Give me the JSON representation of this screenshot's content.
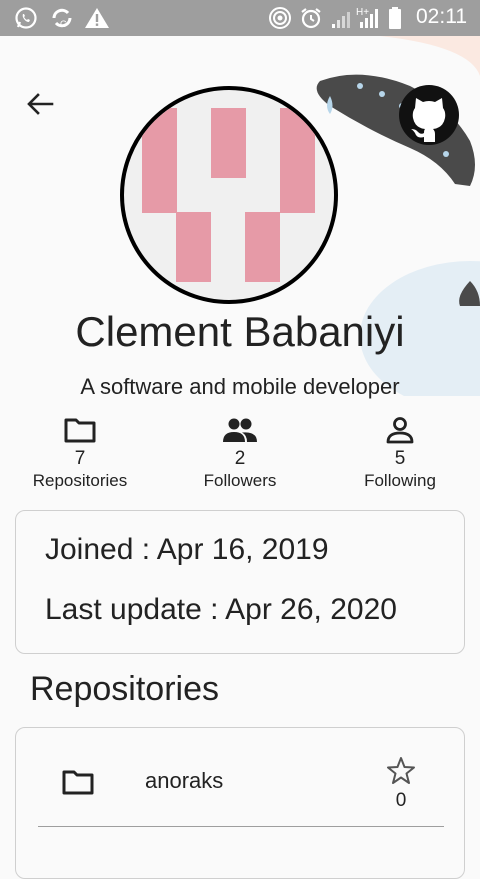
{
  "status_bar": {
    "time": "02:11",
    "left_icons": [
      "whatsapp-icon",
      "sync-data-icon",
      "warning-icon"
    ],
    "right_icons": [
      "hotspot-icon",
      "alarm-icon",
      "signal-icon",
      "mobile-data-signal-icon",
      "battery-icon"
    ],
    "data_type": "H+"
  },
  "header": {
    "back_icon": "arrow-back-icon",
    "logo_icon": "github-icon"
  },
  "profile": {
    "name": "Clement Babaniyi",
    "bio": "A software and mobile developer",
    "avatar_colors": {
      "background": "#f0f0f0",
      "blocks": "#e69aa7"
    }
  },
  "stats": [
    {
      "icon": "folder-icon",
      "value": "7",
      "label": "Repositories"
    },
    {
      "icon": "people-icon",
      "value": "2",
      "label": "Followers"
    },
    {
      "icon": "person-icon",
      "value": "5",
      "label": "Following"
    }
  ],
  "info": {
    "joined": "Joined : Apr 16, 2019",
    "last_update": "Last update : Apr 26, 2020"
  },
  "repositories_section": {
    "title": "Repositories",
    "items": [
      {
        "icon": "folder-icon",
        "name": "anoraks",
        "stars": "0",
        "star_icon": "star-outline-icon"
      }
    ]
  },
  "colors": {
    "status_bar": "#9e9e9e",
    "background": "#fafafa",
    "card_border": "#cfcfcf",
    "deco_dark": "#4a4a4a",
    "deco_light": "#e4eef5"
  }
}
